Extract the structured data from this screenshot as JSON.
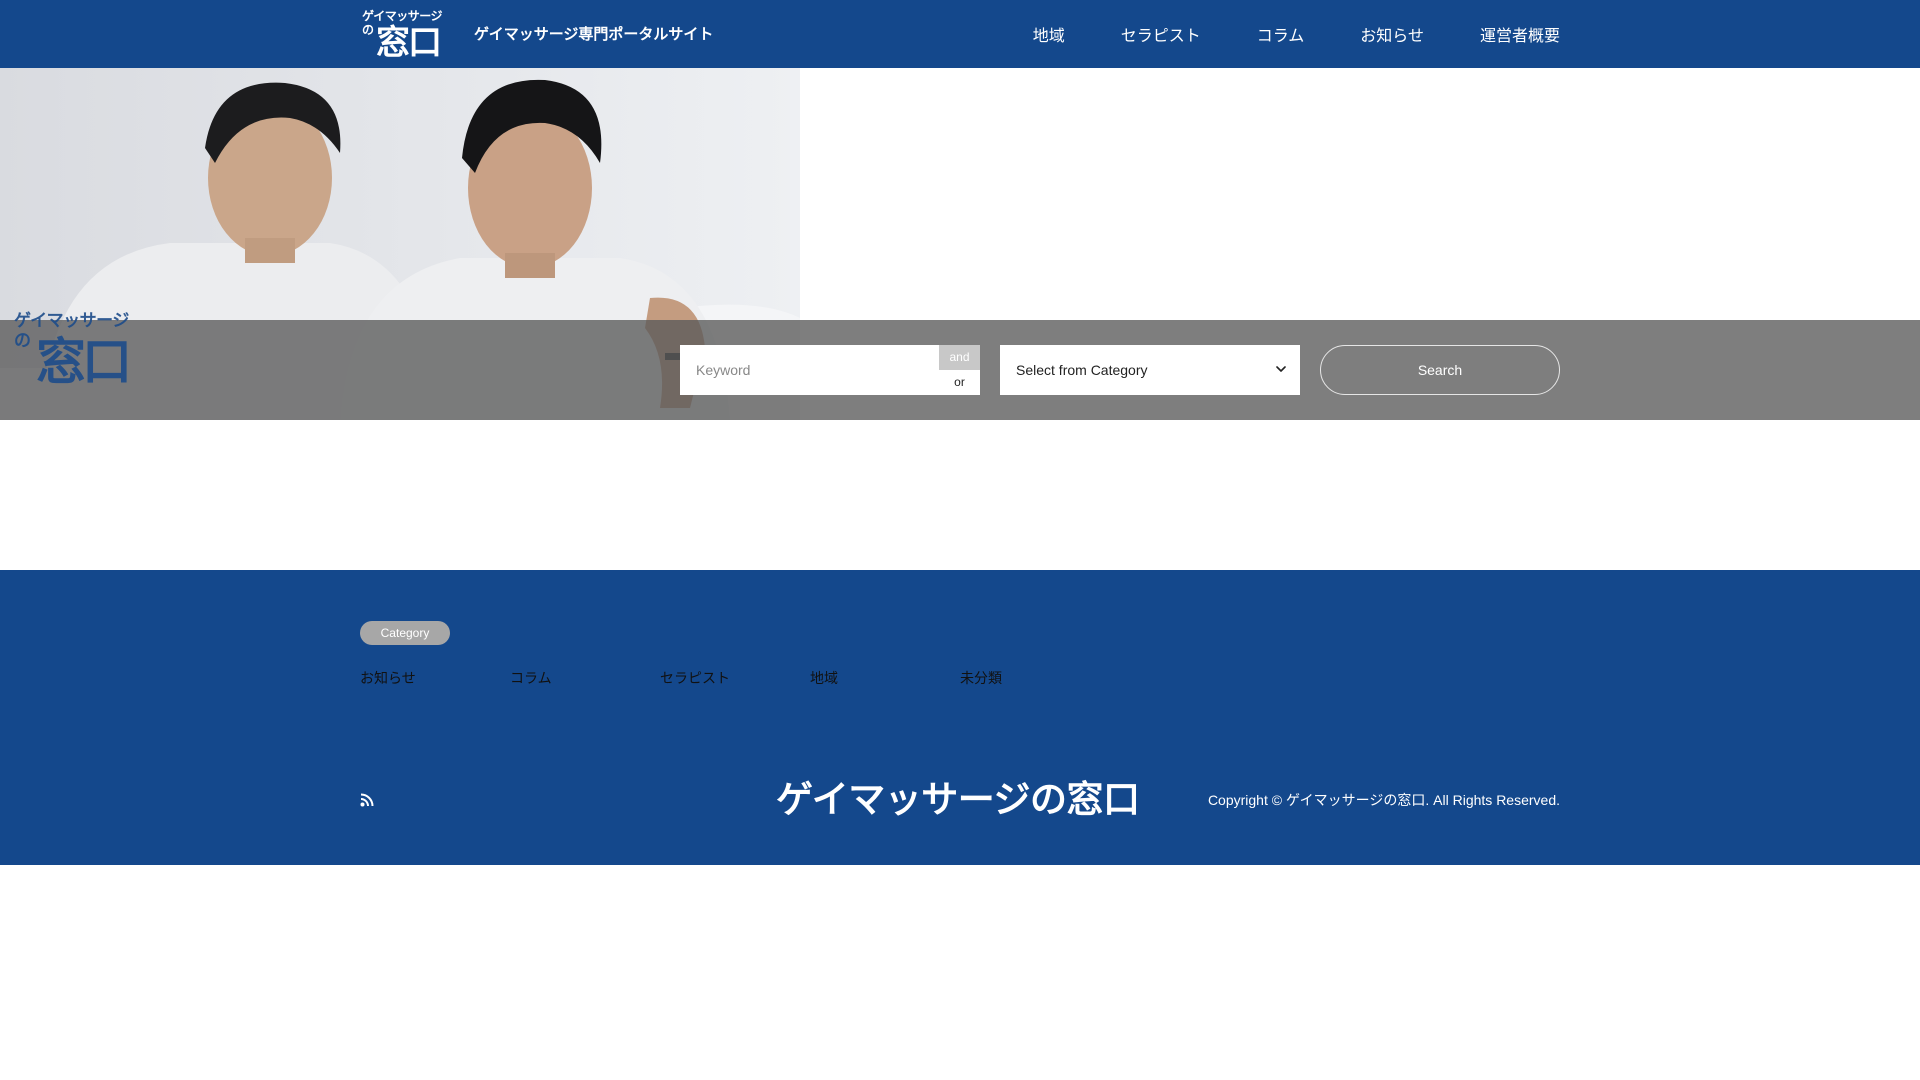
{
  "header": {
    "logo": {
      "line1": "ゲイマッサージ",
      "line2": "の",
      "line3": "窓口"
    },
    "tagline": "ゲイマッサージ専門ポータルサイト",
    "nav": [
      "地域",
      "セラピスト",
      "コラム",
      "お知らせ",
      "運営者概要"
    ]
  },
  "hero": {
    "overlay_logo": {
      "line1": "ゲイマッサージ",
      "line2": "の",
      "line3": "窓口"
    }
  },
  "search": {
    "keyword_placeholder": "Keyword",
    "and_label": "and",
    "or_label": "or",
    "category_selected": "Select from Category",
    "button_label": "Search"
  },
  "footer": {
    "category_badge": "Category",
    "categories": [
      "お知らせ",
      "コラム",
      "セラピスト",
      "地域",
      "未分類"
    ],
    "title": "ゲイマッサージの窓口",
    "copyright": "Copyright © ゲイマッサージの窓口. All Rights Reserved."
  },
  "colors": {
    "brand_blue": "#14488c",
    "search_overlay": "#5a5a5a",
    "badge_gray": "#a7a7a7"
  },
  "icons": {
    "rss": "rss-icon",
    "select_chevron": "chevron-down-icon"
  }
}
